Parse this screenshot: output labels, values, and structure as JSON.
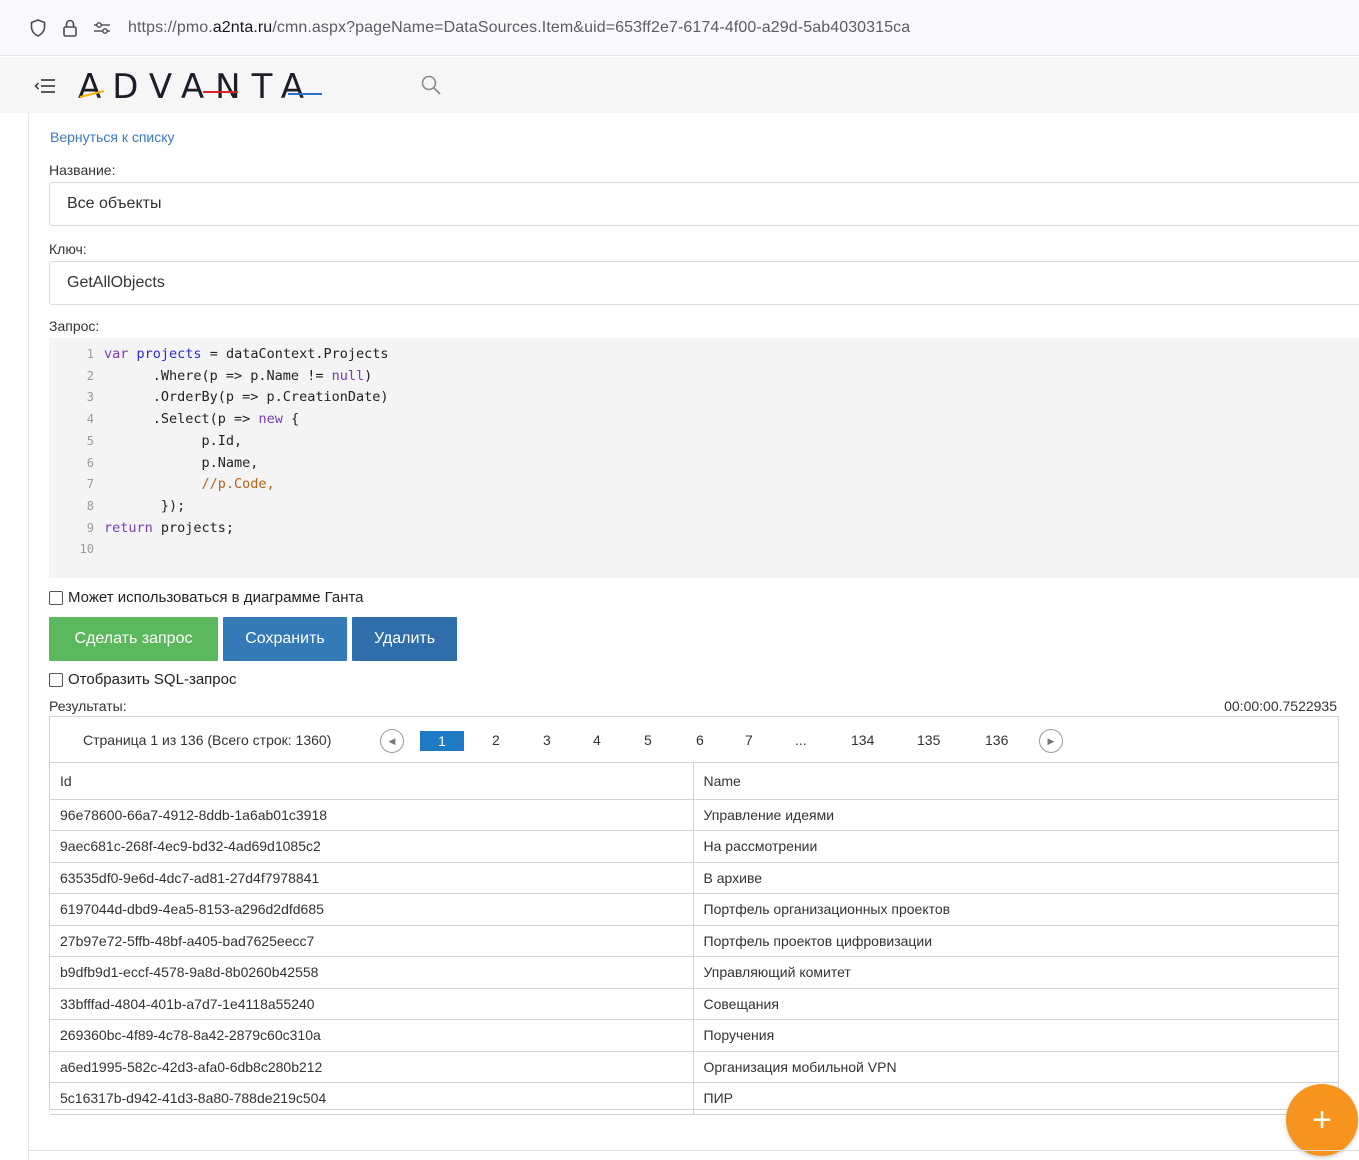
{
  "browser": {
    "url_prefix": "https://pmo.",
    "url_domain": "a2nta.ru",
    "url_rest": "/cmn.aspx?pageName=DataSources.Item&uid=653ff2e7-6174-4f00-a29d-5ab4030315ca"
  },
  "header": {
    "logo_text": "ADVANTA",
    "menu_icon": "collapse-menu-icon",
    "search_icon": "search-icon"
  },
  "form": {
    "back_link": "Вернуться к списку",
    "name_label": "Название:",
    "name_value": "Все объекты",
    "key_label": "Ключ:",
    "key_value": "GetAllObjects",
    "query_label": "Запрос:",
    "code_lines": [
      {
        "n": "1",
        "text": "var projects = dataContext.Projects"
      },
      {
        "n": "2",
        "text": "      .Where(p => p.Name != null)"
      },
      {
        "n": "3",
        "text": "      .OrderBy(p => p.CreationDate)"
      },
      {
        "n": "4",
        "text": "      .Select(p => new {"
      },
      {
        "n": "5",
        "text": "            p.Id,"
      },
      {
        "n": "6",
        "text": "            p.Name,"
      },
      {
        "n": "7",
        "text": "            //p.Code,"
      },
      {
        "n": "8",
        "text": "       });"
      },
      {
        "n": "9",
        "text": "return projects;"
      },
      {
        "n": "10",
        "text": ""
      }
    ],
    "gantt_checkbox_label": "Может использоваться в диаграмме Ганта",
    "run_button": "Сделать запрос",
    "save_button": "Сохранить",
    "delete_button": "Удалить",
    "sql_checkbox_label": "Отобразить SQL-запрос",
    "results_label": "Результаты:",
    "elapsed": "00:00:00.7522935"
  },
  "pager": {
    "summary": "Страница 1 из 136 (Всего строк: 1360)",
    "pages": [
      "1",
      "2",
      "3",
      "4",
      "5",
      "6",
      "7",
      "...",
      "134",
      "135",
      "136"
    ],
    "current": "1"
  },
  "table": {
    "columns": [
      "Id",
      "Name"
    ],
    "rows": [
      [
        "96e78600-66a7-4912-8ddb-1a6ab01c3918",
        "Управление идеями"
      ],
      [
        "9aec681c-268f-4ec9-bd32-4ad69d1085c2",
        "На рассмотрении"
      ],
      [
        "63535df0-9e6d-4dc7-ad81-27d4f7978841",
        "В архиве"
      ],
      [
        "6197044d-dbd9-4ea5-8153-a296d2dfd685",
        "Портфель организационных проектов"
      ],
      [
        "27b97e72-5ffb-48bf-a405-bad7625eecc7",
        "Портфель проектов цифровизации"
      ],
      [
        "b9dfb9d1-eccf-4578-9a8d-8b0260b42558",
        "Управляющий комитет"
      ],
      [
        "33bfffad-4804-401b-a7d7-1e4118a55240",
        "Совещания"
      ],
      [
        "269360bc-4f89-4c78-8a42-2879c60c310a",
        "Поручения"
      ],
      [
        "a6ed1995-582c-42d3-afa0-6db8c280b212",
        "Организация мобильной VPN"
      ],
      [
        "5c16317b-d942-41d3-8a80-788de219c504",
        "ПИР"
      ]
    ]
  },
  "fab": {
    "label": "+",
    "icon": "plus-icon"
  },
  "colors": {
    "primary": "#337ab7",
    "success": "#5cb85c",
    "accent": "#f7941d",
    "link": "#3a78c0"
  }
}
